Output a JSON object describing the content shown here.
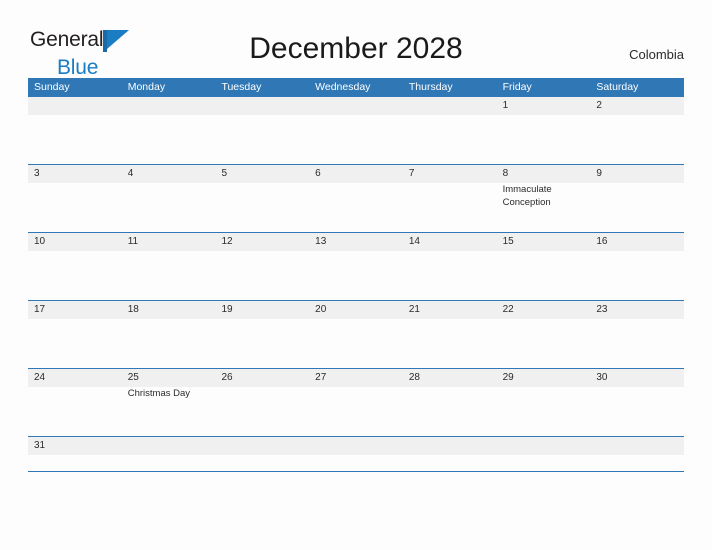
{
  "brand": {
    "name_part1": "General",
    "name_part2": "Blue",
    "flag_icon": "flag-triangle-icon",
    "accent_color": "#1a7dc4"
  },
  "header": {
    "title": "December 2028",
    "country": "Colombia"
  },
  "colors": {
    "header_blue": "#2f77b5",
    "row_gray": "#f0f0f0",
    "page_background": "#fdfdfd",
    "text": "#2b2b2b"
  },
  "calendar": {
    "month": "December",
    "year": "2028",
    "weekdays": [
      "Sunday",
      "Monday",
      "Tuesday",
      "Wednesday",
      "Thursday",
      "Friday",
      "Saturday"
    ],
    "weeks": [
      [
        {
          "day": "",
          "event": ""
        },
        {
          "day": "",
          "event": ""
        },
        {
          "day": "",
          "event": ""
        },
        {
          "day": "",
          "event": ""
        },
        {
          "day": "",
          "event": ""
        },
        {
          "day": "1",
          "event": ""
        },
        {
          "day": "2",
          "event": ""
        }
      ],
      [
        {
          "day": "3",
          "event": ""
        },
        {
          "day": "4",
          "event": ""
        },
        {
          "day": "5",
          "event": ""
        },
        {
          "day": "6",
          "event": ""
        },
        {
          "day": "7",
          "event": ""
        },
        {
          "day": "8",
          "event": "Immaculate Conception"
        },
        {
          "day": "9",
          "event": ""
        }
      ],
      [
        {
          "day": "10",
          "event": ""
        },
        {
          "day": "11",
          "event": ""
        },
        {
          "day": "12",
          "event": ""
        },
        {
          "day": "13",
          "event": ""
        },
        {
          "day": "14",
          "event": ""
        },
        {
          "day": "15",
          "event": ""
        },
        {
          "day": "16",
          "event": ""
        }
      ],
      [
        {
          "day": "17",
          "event": ""
        },
        {
          "day": "18",
          "event": ""
        },
        {
          "day": "19",
          "event": ""
        },
        {
          "day": "20",
          "event": ""
        },
        {
          "day": "21",
          "event": ""
        },
        {
          "day": "22",
          "event": ""
        },
        {
          "day": "23",
          "event": ""
        }
      ],
      [
        {
          "day": "24",
          "event": ""
        },
        {
          "day": "25",
          "event": "Christmas Day"
        },
        {
          "day": "26",
          "event": ""
        },
        {
          "day": "27",
          "event": ""
        },
        {
          "day": "28",
          "event": ""
        },
        {
          "day": "29",
          "event": ""
        },
        {
          "day": "30",
          "event": ""
        }
      ],
      [
        {
          "day": "31",
          "event": ""
        },
        {
          "day": "",
          "event": ""
        },
        {
          "day": "",
          "event": ""
        },
        {
          "day": "",
          "event": ""
        },
        {
          "day": "",
          "event": ""
        },
        {
          "day": "",
          "event": ""
        },
        {
          "day": "",
          "event": ""
        }
      ]
    ]
  }
}
